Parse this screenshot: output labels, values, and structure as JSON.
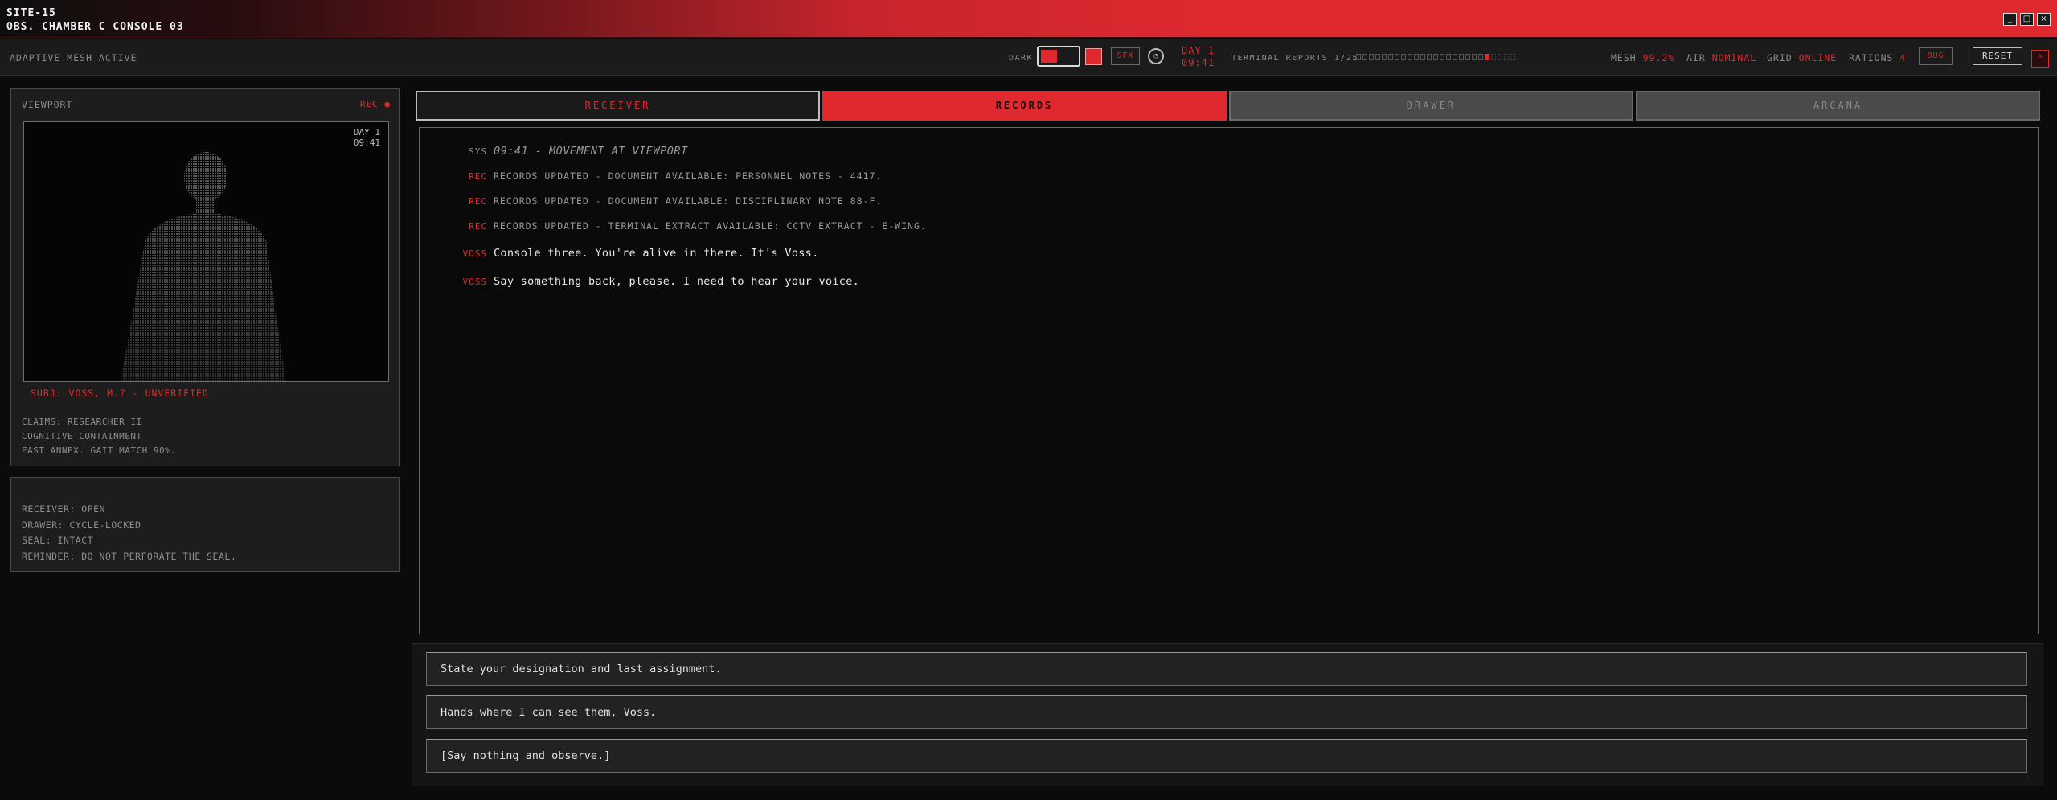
{
  "window": {
    "title_line1": "SITE-15",
    "title_line2": "OBS. CHAMBER C CONSOLE 03",
    "controls": [
      "_",
      "□",
      "×"
    ]
  },
  "statusbar": {
    "mesh_status": "ADAPTIVE MESH ACTIVE",
    "dark_label": "DARK",
    "sfx_label": "SFX",
    "day": "DAY 1",
    "time": "09:41",
    "terminal_reports_label": "TERMINAL REPORTS",
    "terminal_reports_count": "1/25",
    "terminal_reports_progress": 0.04,
    "mesh_label": "MESH",
    "mesh_value": "99.2%",
    "air_label": "AIR",
    "air_value": "NOMINAL",
    "grid_label": "GRID",
    "grid_value": "ONLINE",
    "rations_label": "RATIONS",
    "rations_value": "4",
    "bug_label": "BUG",
    "reset_label": "RESET",
    "accent_color": "#e0292f"
  },
  "viewport": {
    "title": "VIEWPORT",
    "rec_label": "REC ●",
    "stamp_day": "DAY 1",
    "stamp_time": "09:41",
    "subject": "SUBJ: VOSS, M.? - UNVERIFIED",
    "claims": [
      "CLAIMS: RESEARCHER II",
      "COGNITIVE CONTAINMENT",
      "EAST ANNEX. GAIT MATCH 90%."
    ]
  },
  "status_panel": {
    "lines": [
      "RECEIVER: OPEN",
      "DRAWER: CYCLE-LOCKED",
      "SEAL: INTACT",
      "REMINDER: DO NOT PERFORATE THE SEAL."
    ]
  },
  "tabs": [
    {
      "label": "RECEIVER",
      "state": "normal"
    },
    {
      "label": "RECORDS",
      "state": "active"
    },
    {
      "label": "DRAWER",
      "state": "dim"
    },
    {
      "label": "ARCANA",
      "state": "dim"
    }
  ],
  "log": [
    {
      "tag": "SYS",
      "kind": "sys",
      "text": "09:41 - MOVEMENT AT VIEWPORT"
    },
    {
      "tag": "REC",
      "kind": "rec",
      "text": "RECORDS UPDATED - DOCUMENT AVAILABLE: PERSONNEL NOTES - 4417."
    },
    {
      "tag": "REC",
      "kind": "rec",
      "text": "RECORDS UPDATED - DOCUMENT AVAILABLE: DISCIPLINARY NOTE 88-F."
    },
    {
      "tag": "REC",
      "kind": "rec",
      "text": "RECORDS UPDATED - TERMINAL EXTRACT AVAILABLE: CCTV EXTRACT - E-WING."
    },
    {
      "tag": "VOSS",
      "kind": "voss",
      "text": "Console three. You're alive in there. It's Voss."
    },
    {
      "tag": "VOSS",
      "kind": "voss",
      "text": "Say something back, please. I need to hear your voice."
    }
  ],
  "choices": [
    "State your designation and last assignment.",
    "Hands where I can see them, Voss.",
    "[Say nothing and observe.]"
  ]
}
